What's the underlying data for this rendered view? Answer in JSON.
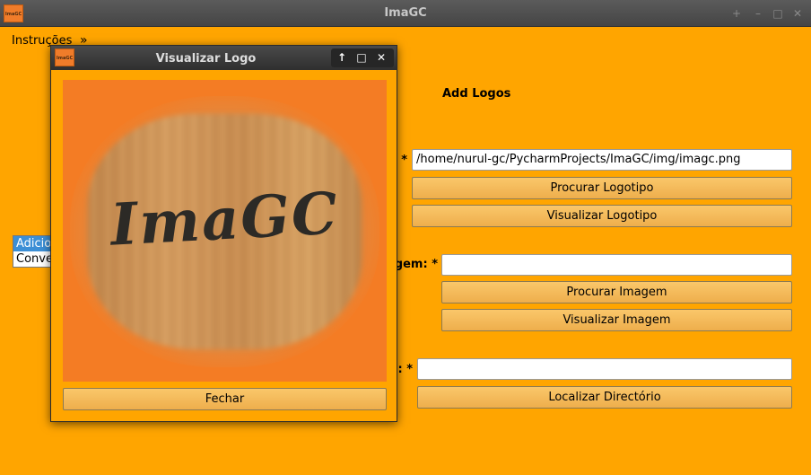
{
  "window": {
    "title": "ImaGC",
    "icon_text": "ImaGC",
    "controls": [
      "+",
      "–",
      "□",
      "✕"
    ]
  },
  "menu": {
    "items": [
      "Instruções"
    ],
    "overflow": "»"
  },
  "main": {
    "section_title": "Add Logos",
    "list_items": [
      "Adicionar",
      "Converter"
    ],
    "logo_field": {
      "label_visible": "*",
      "value": "/home/nurul-gc/PycharmProjects/ImaGC/img/imagc.png"
    },
    "browse_logo_label": "Procurar Logotipo",
    "view_logo_label": "Visualizar Logotipo",
    "image_field": {
      "label_visible": "gem: *",
      "value": ""
    },
    "browse_image_label": "Procurar Imagem",
    "view_image_label": "Visualizar Imagem",
    "directory_field": {
      "label_visible": ": *",
      "value": ""
    },
    "locate_directory_label": "Localizar Directório"
  },
  "dialog": {
    "title": "Visualizar Logo",
    "icon_text": "ImaGC",
    "controls": [
      "↑",
      "□",
      "✕"
    ],
    "logo_text": "ImaGC",
    "close_label": "Fechar"
  },
  "colors": {
    "background": "#ffa500",
    "button": "#f4b95a",
    "preview_background": "#f47c24",
    "selection": "#3c8fd6"
  }
}
